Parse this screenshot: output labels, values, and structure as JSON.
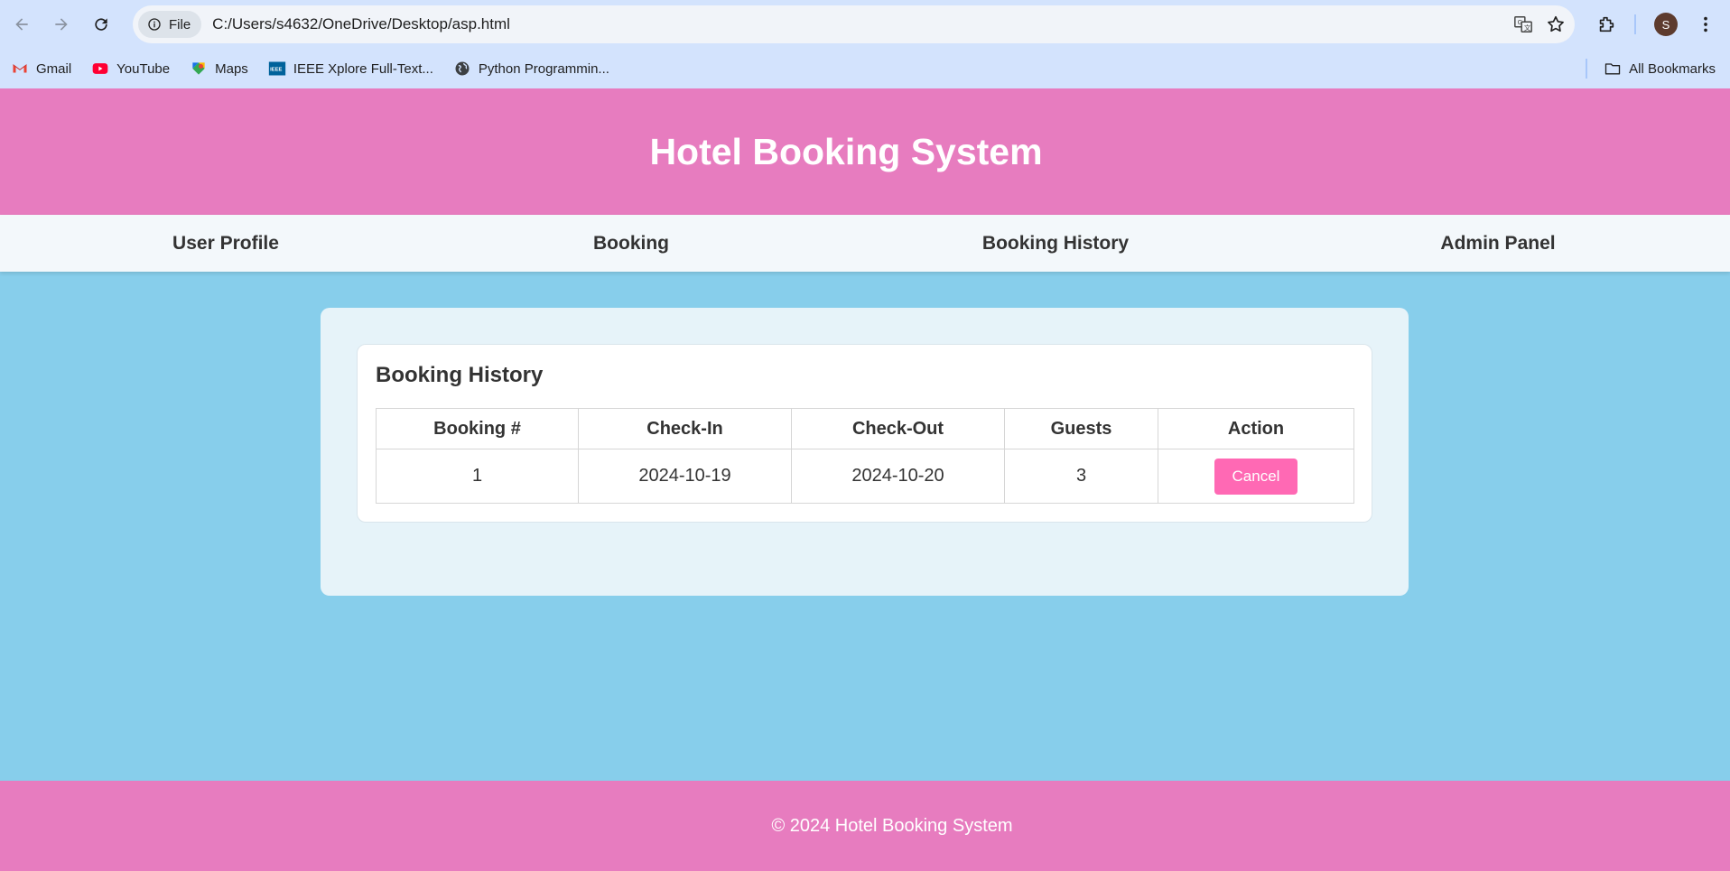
{
  "browser": {
    "url": "C:/Users/s4632/OneDrive/Desktop/asp.html",
    "site_chip": "File",
    "avatar_letter": "S",
    "bookmarks": [
      {
        "label": "Gmail",
        "icon": "gmail-icon"
      },
      {
        "label": "YouTube",
        "icon": "youtube-icon"
      },
      {
        "label": "Maps",
        "icon": "maps-icon"
      },
      {
        "label": "IEEE Xplore Full-Text...",
        "icon": "ieee-icon"
      },
      {
        "label": "Python Programmin...",
        "icon": "globe-icon"
      }
    ],
    "all_bookmarks": "All Bookmarks"
  },
  "header": {
    "title": "Hotel Booking System"
  },
  "nav": {
    "items": [
      {
        "label": "User Profile"
      },
      {
        "label": "Booking"
      },
      {
        "label": "Booking History"
      },
      {
        "label": "Admin Panel"
      }
    ]
  },
  "history": {
    "title": "Booking History",
    "columns": [
      "Booking #",
      "Check-In",
      "Check-Out",
      "Guests",
      "Action"
    ],
    "rows": [
      {
        "booking_no": "1",
        "check_in": "2024-10-19",
        "check_out": "2024-10-20",
        "guests": "3",
        "action_label": "Cancel"
      }
    ]
  },
  "footer": {
    "text": "© 2024 Hotel Booking System"
  },
  "colors": {
    "header_bg": "#e77cbf",
    "page_bg": "#87ceeb",
    "cancel_btn": "#ff69b4"
  }
}
